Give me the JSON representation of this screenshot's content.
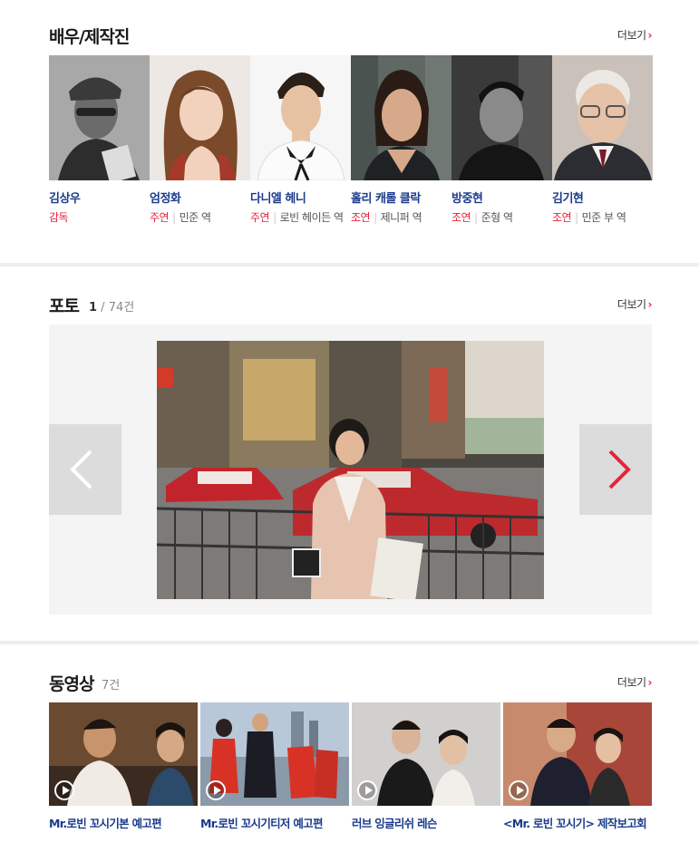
{
  "cast_section": {
    "title": "배우/제작진",
    "more_label": "더보기",
    "items": [
      {
        "name": "김상우",
        "role_type": "감독",
        "character": ""
      },
      {
        "name": "엄정화",
        "role_type": "주연",
        "character": "민준 역"
      },
      {
        "name": "다니엘 헤니",
        "role_type": "주연",
        "character": "로빈 헤이든 역"
      },
      {
        "name": "홀리 캐롤 클락",
        "role_type": "조연",
        "character": "제니퍼 역"
      },
      {
        "name": "방중현",
        "role_type": "조연",
        "character": "준형 역"
      },
      {
        "name": "김기현",
        "role_type": "조연",
        "character": "민준 부 역"
      }
    ]
  },
  "photo_section": {
    "title": "포토",
    "current": "1",
    "total": "74건",
    "more_label": "더보기"
  },
  "video_section": {
    "title": "동영상",
    "count": "7건",
    "more_label": "더보기",
    "items": [
      {
        "title": "Mr.로빈 꼬시기본 예고편"
      },
      {
        "title": "Mr.로빈 꼬시기티저 예고편"
      },
      {
        "title": "러브 잉글리쉬 레슨"
      },
      {
        "title": "<Mr. 로빈 꼬시기> 제작보고회"
      }
    ]
  },
  "colors": {
    "accent": "#e4253d",
    "link": "#1a3a8a",
    "divider": "#eeeeee",
    "stage": "#f4f4f4"
  },
  "icons": {
    "more": "chevron-right-icon",
    "prev": "chevron-left-icon",
    "next": "chevron-right-icon",
    "play": "play-icon"
  }
}
